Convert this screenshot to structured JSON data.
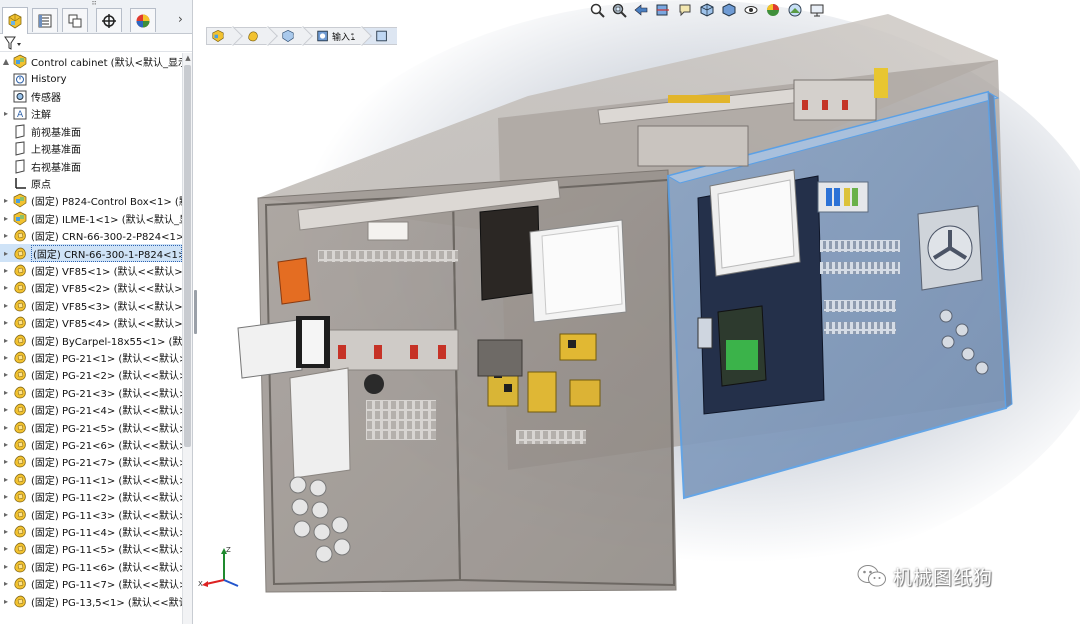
{
  "panel": {
    "tabs": [
      {
        "name": "featuremanager-tab",
        "icon": "feature-tree-icon"
      },
      {
        "name": "propertymanager-tab",
        "icon": "property-list-icon"
      },
      {
        "name": "configuration-tab",
        "icon": "configuration-icon"
      },
      {
        "name": "dimxpert-tab",
        "icon": "crosshair-icon"
      },
      {
        "name": "display-manager-tab",
        "icon": "appearance-pie-icon"
      }
    ],
    "more_tabs_glyph": "›",
    "grip_glyph": "⠿"
  },
  "tree": {
    "root": "Control cabinet  (默认<默认_显示状",
    "items": [
      {
        "label": "History",
        "icon": "history-icon",
        "expand": false
      },
      {
        "label": "传感器",
        "icon": "sensor-icon",
        "expand": false
      },
      {
        "label": "注解",
        "icon": "annotation-icon",
        "expand": true
      },
      {
        "label": "前视基准面",
        "icon": "plane-icon",
        "expand": false
      },
      {
        "label": "上视基准面",
        "icon": "plane-icon",
        "expand": false
      },
      {
        "label": "右视基准面",
        "icon": "plane-icon",
        "expand": false
      },
      {
        "label": "原点",
        "icon": "origin-icon",
        "expand": false
      },
      {
        "label": "(固定) P824-Control Box<1> (默",
        "icon": "assembly-icon",
        "expand": true
      },
      {
        "label": "(固定) ILME-1<1> (默认<默认_显",
        "icon": "assembly-icon",
        "expand": true
      },
      {
        "label": "(固定) CRN-66-300-2-P824<1>",
        "icon": "part-icon",
        "expand": true
      },
      {
        "label": "(固定) CRN-66-300-1-P824<1>",
        "icon": "part-icon",
        "expand": true,
        "selected": true
      },
      {
        "label": "(固定) VF85<1> (默认<<默认>_",
        "icon": "part-icon",
        "expand": true
      },
      {
        "label": "(固定) VF85<2> (默认<<默认>_",
        "icon": "part-icon",
        "expand": true
      },
      {
        "label": "(固定) VF85<3> (默认<<默认>_",
        "icon": "part-icon",
        "expand": true
      },
      {
        "label": "(固定) VF85<4> (默认<<默认>_",
        "icon": "part-icon",
        "expand": true
      },
      {
        "label": "(固定) ByCarpel-18x55<1> (默认",
        "icon": "part-icon",
        "expand": true
      },
      {
        "label": "(固定) PG-21<1> (默认<<默认>",
        "icon": "part-icon",
        "expand": true
      },
      {
        "label": "(固定) PG-21<2> (默认<<默认>",
        "icon": "part-icon",
        "expand": true
      },
      {
        "label": "(固定) PG-21<3> (默认<<默认>",
        "icon": "part-icon",
        "expand": true
      },
      {
        "label": "(固定) PG-21<4> (默认<<默认>",
        "icon": "part-icon",
        "expand": true
      },
      {
        "label": "(固定) PG-21<5> (默认<<默认>",
        "icon": "part-icon",
        "expand": true
      },
      {
        "label": "(固定) PG-21<6> (默认<<默认>",
        "icon": "part-icon",
        "expand": true
      },
      {
        "label": "(固定) PG-21<7> (默认<<默认>",
        "icon": "part-icon",
        "expand": true
      },
      {
        "label": "(固定) PG-11<1> (默认<<默认>",
        "icon": "part-icon",
        "expand": true
      },
      {
        "label": "(固定) PG-11<2> (默认<<默认>",
        "icon": "part-icon",
        "expand": true
      },
      {
        "label": "(固定) PG-11<3> (默认<<默认>",
        "icon": "part-icon",
        "expand": true
      },
      {
        "label": "(固定) PG-11<4> (默认<<默认>",
        "icon": "part-icon",
        "expand": true
      },
      {
        "label": "(固定) PG-11<5> (默认<<默认>",
        "icon": "part-icon",
        "expand": true
      },
      {
        "label": "(固定) PG-11<6> (默认<<默认>",
        "icon": "part-icon",
        "expand": true
      },
      {
        "label": "(固定) PG-11<7> (默认<<默认>",
        "icon": "part-icon",
        "expand": true
      },
      {
        "label": "(固定) PG-13,5<1> (默认<<默认",
        "icon": "part-icon",
        "expand": true
      }
    ]
  },
  "viewport": {
    "breadcrumb": [
      {
        "label": "",
        "icon": "assembly-icon"
      },
      {
        "label": "",
        "icon": "part-icon"
      },
      {
        "label": "",
        "icon": "part-cube-icon"
      },
      {
        "label": "输入1",
        "icon": "feature-icon"
      },
      {
        "label": "",
        "icon": "sketch-icon"
      }
    ],
    "hud_icons": [
      "zoom-to-fit-icon",
      "zoom-to-area-icon",
      "previous-view-icon",
      "section-view-icon",
      "dynamic-annotation-icon",
      "view-orientation-icon",
      "display-style-icon",
      "hide-show-icon",
      "edit-appearance-icon",
      "apply-scene-icon",
      "view-settings-icon"
    ],
    "triad_axes": [
      "Z",
      "X"
    ],
    "watermark": "机械图纸狗"
  },
  "colors": {
    "selection": "#cfe3f7",
    "selected_box_outline": "#5aa0e6",
    "cabinet_gray": "#9a9490",
    "accent_yellow": "#e0b52a"
  }
}
